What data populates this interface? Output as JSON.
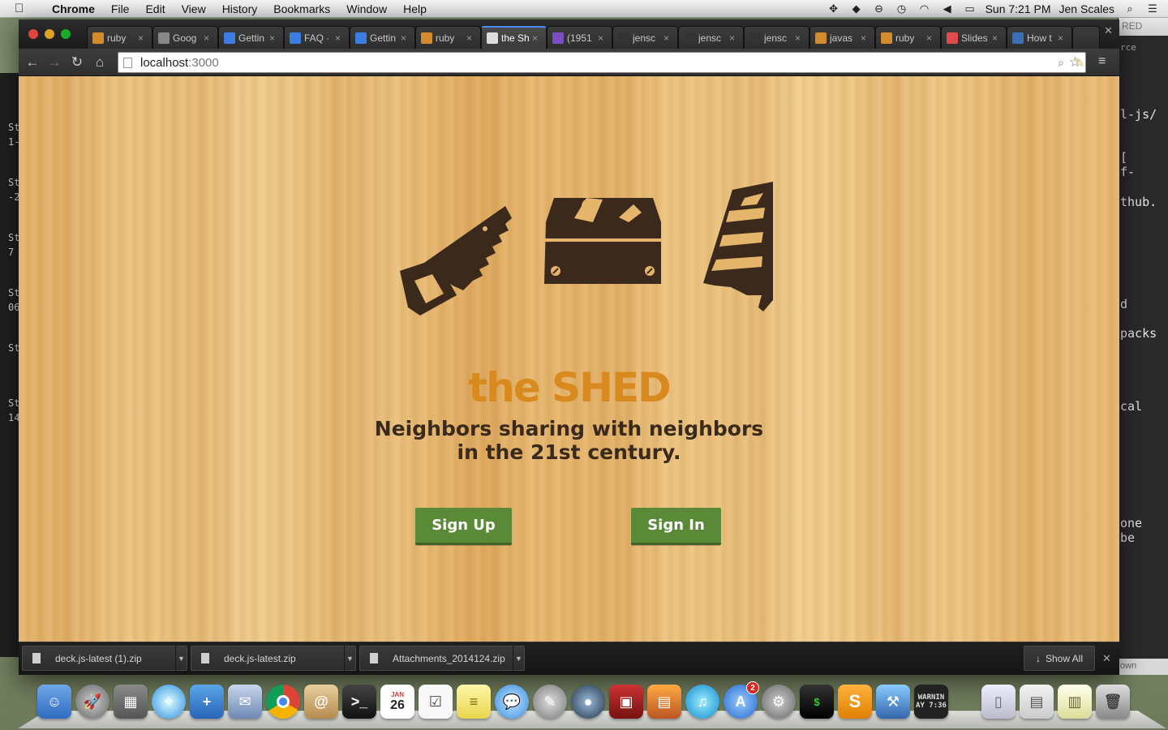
{
  "menubar": {
    "apple": "",
    "app_name": "Chrome",
    "menus": [
      "File",
      "Edit",
      "View",
      "History",
      "Bookmarks",
      "Window",
      "Help"
    ],
    "clock": "Sun 7:21 PM",
    "user": "Jen Scales"
  },
  "tabs": [
    {
      "title": "ruby",
      "favicon": "stackoverflow-icon",
      "color": "#d38b2e"
    },
    {
      "title": "Goog",
      "favicon": "doc-icon",
      "color": "#888888"
    },
    {
      "title": "Gettin",
      "favicon": "brackets-icon",
      "color": "#3b7de0"
    },
    {
      "title": "FAQ ·",
      "favicon": "brackets-icon",
      "color": "#3b7de0"
    },
    {
      "title": "Gettin",
      "favicon": "brackets-icon",
      "color": "#3b7de0"
    },
    {
      "title": "ruby",
      "favicon": "stackoverflow-icon",
      "color": "#d38b2e"
    },
    {
      "title": "the Sh",
      "favicon": "page-icon",
      "color": "#dddddd",
      "active": true
    },
    {
      "title": "(1951",
      "favicon": "mail-icon",
      "color": "#7b4fc4"
    },
    {
      "title": "jensc",
      "favicon": "github-icon",
      "color": "#333333"
    },
    {
      "title": "jensc",
      "favicon": "github-icon",
      "color": "#333333"
    },
    {
      "title": "jensc",
      "favicon": "github-icon",
      "color": "#333333"
    },
    {
      "title": "javas",
      "favicon": "stackoverflow-icon",
      "color": "#d38b2e"
    },
    {
      "title": "ruby",
      "favicon": "stackoverflow-icon",
      "color": "#d38b2e"
    },
    {
      "title": "Slides",
      "favicon": "slides-icon",
      "color": "#e24b4b"
    },
    {
      "title": "How t",
      "favicon": "browser-icon",
      "color": "#3b6fb6"
    }
  ],
  "omnibox": {
    "host": "localhost",
    "port": ":3000"
  },
  "hero": {
    "title": "the SHED",
    "tagline_line1": "Neighbors sharing with neighbors",
    "tagline_line2": "in the 21st century.",
    "signup_label": "Sign Up",
    "signin_label": "Sign In"
  },
  "downloads": {
    "items": [
      "deck.js-latest (1).zip",
      "deck.js-latest.zip",
      "Attachments_2014124.zip"
    ],
    "show_all": "Show All"
  },
  "bg_terminal_right": {
    "lines": [
      "l-js/",
      "[",
      "f-",
      "thub.",
      "d",
      "packs",
      "cal",
      "one",
      "be"
    ],
    "header": "RED",
    "footer": "own",
    "edge": "rce"
  },
  "bg_terminal_left": {
    "lines": [
      "St",
      "1-",
      "St",
      "-2",
      "St",
      "7",
      "St",
      "06",
      "St",
      "St",
      "14"
    ]
  },
  "dock": {
    "calendar_day": "26",
    "calendar_month": "JAN",
    "appstore_badge": "2",
    "console_label": "WARNIN",
    "console_time": "AY 7:36"
  },
  "colors": {
    "title_orange": "#d88a1e",
    "tagline_brown": "#3a2a1c",
    "button_green": "#5a8a38",
    "icon_brown": "#3b2a1c"
  }
}
